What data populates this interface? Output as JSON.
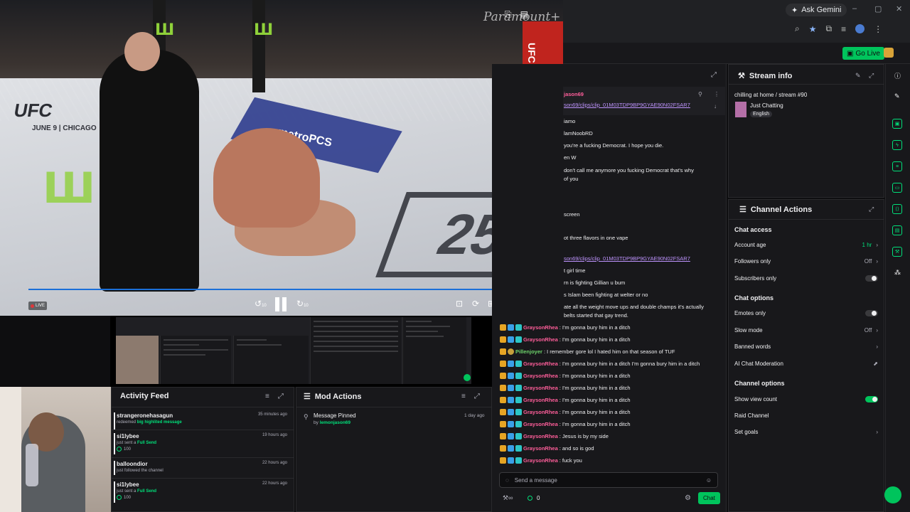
{
  "browser": {
    "gemini_label": "Ask Gemini",
    "window_controls": [
      "–",
      "▢",
      "✕"
    ],
    "golive_label": "Go Live"
  },
  "video": {
    "watermark": "Paramount+",
    "live_label": "LIVE",
    "ufc_banner": "UFC",
    "date_banner": "JUNE 9 | CHICAGO",
    "sponsor": "metroPCS",
    "fightpass": "UFC FIGHT PASS",
    "years": "25",
    "skip_back": "10",
    "skip_forward": "10"
  },
  "activity_feed": {
    "title": "Activity Feed",
    "items": [
      {
        "user": "strangeronehasagun",
        "prefix": "redeemed",
        "highlight": "big highlited message",
        "time": "35 minutes ago",
        "points": ""
      },
      {
        "user": "si1lybee",
        "prefix": "just sent a",
        "highlight": "Full Send",
        "time": "19 hours ago",
        "points": "100"
      },
      {
        "user": "balloondior",
        "prefix": "just followed the channel",
        "highlight": "",
        "time": "22 hours ago",
        "points": ""
      },
      {
        "user": "si1lybee",
        "prefix": "just sent a",
        "highlight": "Full Send",
        "time": "22 hours ago",
        "points": "100"
      }
    ]
  },
  "mod_actions": {
    "title": "Mod Actions",
    "item_title": "Message Pinned",
    "item_by_prefix": "by",
    "item_by_user": "lemonjason69",
    "item_time": "1 day ago"
  },
  "chat": {
    "pinned_user": "jason69",
    "pinned_link": "son69/clips/clip_01M03TDP9BP9GYAE90N02FSAR7",
    "partial_lines": [
      "iamo",
      "lamNoobRD",
      "you're a fucking Democrat. I hope you die.",
      "en W",
      "don't call me anymore you fucking Democrat that's why",
      "of you",
      "screen",
      "ot three flavors in one vape",
      "",
      "son69/clips/clip_01M03TDP9BP9GYAE90N02FSAR7",
      "t girl time",
      "rn is fighting Gillian u bum",
      "s Islam been fighting at welter or no",
      "ate all the weight move ups and double champs it's actually",
      "belts started that gay trend."
    ],
    "messages": [
      {
        "user": "GraysonRhea",
        "text": "I'm gonna bury him in a ditch",
        "type": "grayson"
      },
      {
        "user": "GraysonRhea",
        "text": "I'm gonna bury him in a ditch",
        "type": "grayson"
      },
      {
        "user": "Pillenjoyer",
        "text": "I remember gore lol I hated him on that season of TUF",
        "type": "pill"
      },
      {
        "user": "GraysonRhea",
        "text": "I'm gonna bury him in a ditch I'm gonna bury him in a ditch",
        "type": "grayson"
      },
      {
        "user": "GraysonRhea",
        "text": "I'm gonna bury him in a ditch",
        "type": "grayson"
      },
      {
        "user": "GraysonRhea",
        "text": "I'm gonna bury him in a ditch",
        "type": "grayson"
      },
      {
        "user": "GraysonRhea",
        "text": "I'm gonna bury him in a ditch",
        "type": "grayson"
      },
      {
        "user": "GraysonRhea",
        "text": "I'm gonna bury him in a ditch",
        "type": "grayson"
      },
      {
        "user": "GraysonRhea",
        "text": "I'm gonna bury him in a ditch",
        "type": "grayson"
      },
      {
        "user": "GraysonRhea",
        "text": "Jesus is by my side",
        "type": "grayson"
      },
      {
        "user": "GraysonRhea",
        "text": "and so is god",
        "type": "grayson"
      },
      {
        "user": "GraysonRhea",
        "text": "fuck you",
        "type": "grayson"
      }
    ],
    "input_placeholder": "Send a message",
    "points": "0",
    "send_label": "Chat"
  },
  "stream_info": {
    "title": "Stream info",
    "stream_title": "chilling at home / stream #90",
    "category": "Just Chatting",
    "tag": "English"
  },
  "channel_actions": {
    "title": "Channel Actions",
    "chat_access_head": "Chat access",
    "account_age_label": "Account age",
    "account_age_value": "1 hr",
    "followers_only_label": "Followers only",
    "followers_only_value": "Off",
    "subscribers_only_label": "Subscribers only",
    "chat_options_head": "Chat options",
    "emotes_only_label": "Emotes only",
    "slow_mode_label": "Slow mode",
    "slow_mode_value": "Off",
    "banned_words_label": "Banned words",
    "ai_mod_label": "AI Chat Moderation",
    "channel_options_head": "Channel options",
    "show_view_count_label": "Show view count",
    "raid_label": "Raid Channel",
    "goals_label": "Set goals"
  },
  "colors": {
    "accent": "#00c45c",
    "background": "#0e0e10",
    "panel": "#18181b",
    "grayson": "#ff5e9a",
    "pill": "#6ed36b",
    "link": "#bf94ff"
  }
}
